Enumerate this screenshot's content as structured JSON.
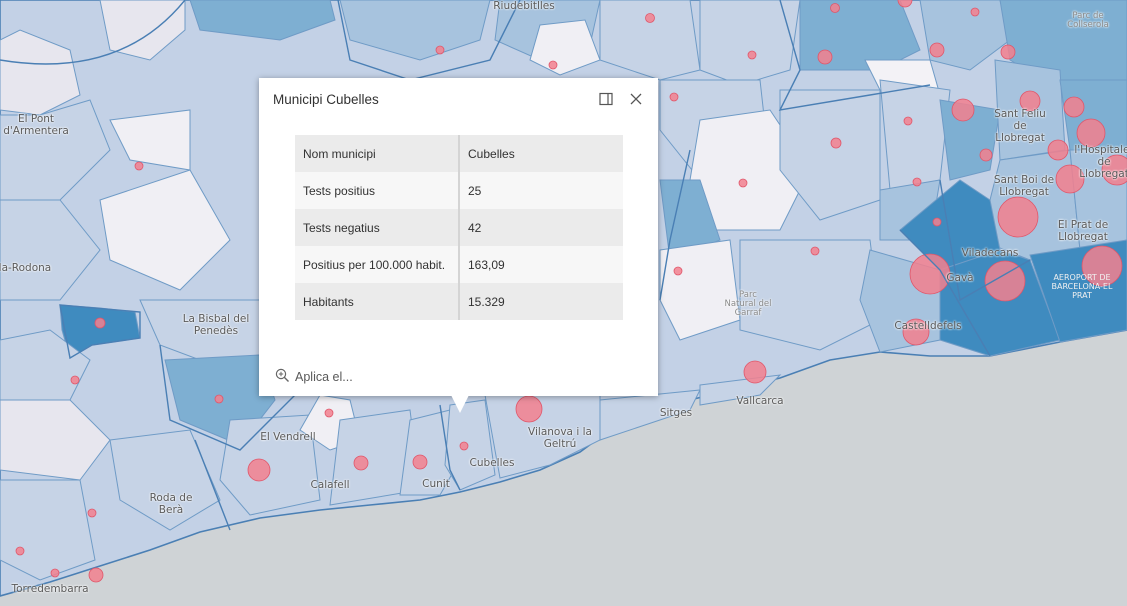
{
  "map": {
    "place_labels": [
      "Riudebitlles",
      "Parc de Collserola",
      "El Pont d'Armentera",
      "Vila-Rodona",
      "La Bisbal del Penedès",
      "El Vendrell",
      "Calafell",
      "Cunit",
      "Cubelles",
      "Roda de Berà",
      "Torredembarra",
      "Vilanova i la Geltrú",
      "Sitges",
      "Vallcarca",
      "Parc Natural del Garraf",
      "Castelldefels",
      "Gavà",
      "Viladecans",
      "Sant Boi de Llobregat",
      "Sant Feliu de Llobregat",
      "l'Hospitalet de Llobregat",
      "El Prat de Llobregat",
      "AEROPORT DE BARCELONA-EL PRAT"
    ],
    "colors": {
      "sea": "#cfd3d6",
      "land_light": "#e9e8ef",
      "choropleth_low": "#c6d3e6",
      "choropleth_mid": "#a7c3de",
      "choropleth_high": "#7eafd2",
      "choropleth_top": "#3f8bbf",
      "circle_fill": "#f2808e",
      "boundary": "#4a7fb4"
    }
  },
  "popup": {
    "title": "Municipi Cubelles",
    "dock_icon": "dock-panel-icon",
    "close_icon": "close-icon",
    "fields": [
      {
        "label": "Nom municipi",
        "value": "Cubelles"
      },
      {
        "label": "Tests positius",
        "value": "25"
      },
      {
        "label": "Tests negatius",
        "value": "42"
      },
      {
        "label": "Positius per 100.000 habit.",
        "value": "163,09"
      },
      {
        "label": "Habitants",
        "value": "15.329"
      }
    ],
    "action_icon": "zoom-in-icon",
    "action_label": "Aplica el..."
  }
}
